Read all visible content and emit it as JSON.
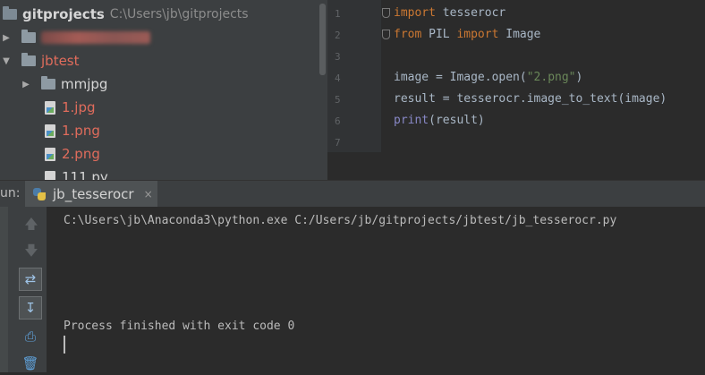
{
  "project_tree": {
    "root": {
      "name": "gitprojects",
      "path": "C:\\Users\\jb\\gitprojects"
    },
    "items": [
      {
        "kind": "folder-blurred",
        "label": ""
      },
      {
        "kind": "folder",
        "label": "jbtest"
      },
      {
        "kind": "folder",
        "label": "mmjpg"
      },
      {
        "kind": "image",
        "label": "1.jpg"
      },
      {
        "kind": "image",
        "label": "1.png"
      },
      {
        "kind": "image",
        "label": "2.png"
      },
      {
        "kind": "python",
        "label": "111.py"
      }
    ]
  },
  "editor": {
    "line_numbers": [
      "1",
      "2",
      "3",
      "4",
      "5",
      "6",
      "7"
    ],
    "lines": {
      "l1": {
        "kw": "import",
        "rest": " tesserocr"
      },
      "l2": {
        "kw1": "from",
        "mid": " PIL ",
        "kw2": "import",
        "rest": " Image"
      },
      "l4": {
        "pre": "image = Image.open(",
        "str": "\"2.png\"",
        "post": ")"
      },
      "l5": {
        "text": "result = tesserocr.image_to_text(image)"
      },
      "l6": {
        "builtin": "print",
        "rest": "(result)"
      }
    }
  },
  "run_panel": {
    "label": "un:",
    "tab_title": "jb_tesserocr",
    "tab_close": "×",
    "console": {
      "command": "C:\\Users\\jb\\Anaconda3\\python.exe C:/Users/jb/gitprojects/jbtest/jb_tesserocr.py",
      "finished": "Process finished with exit code 0"
    },
    "toolbar_icons": [
      "arrow-up-icon",
      "arrow-down-icon",
      "soft-wrap-icon",
      "scroll-to-end-icon",
      "print-icon",
      "trash-icon"
    ]
  },
  "colors": {
    "keyword": "#cc7832",
    "string": "#6a8759",
    "builtin": "#8888c6",
    "modified_file": "#e06c5c"
  }
}
